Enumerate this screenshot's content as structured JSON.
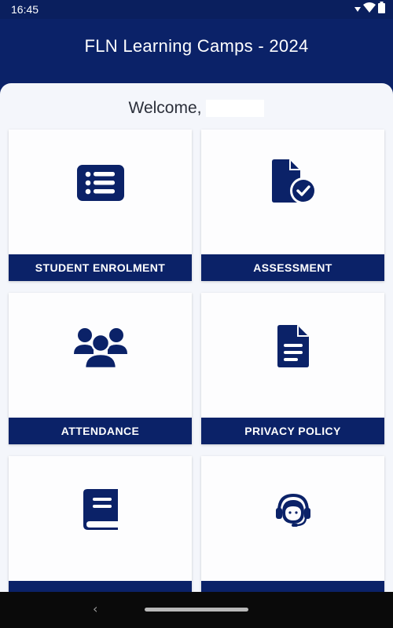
{
  "status_bar": {
    "time": "16:45",
    "icons": [
      "signal-dropdown-icon",
      "wifi-icon",
      "battery-icon"
    ]
  },
  "header": {
    "title": "FLN Learning Camps - 2024"
  },
  "welcome": {
    "greeting": "Welcome,",
    "user_name": ""
  },
  "tiles": [
    {
      "label": "STUDENT ENROLMENT",
      "icon": "list-icon"
    },
    {
      "label": "ASSESSMENT",
      "icon": "document-check-icon"
    },
    {
      "label": "ATTENDANCE",
      "icon": "group-icon"
    },
    {
      "label": "PRIVACY POLICY",
      "icon": "document-icon"
    },
    {
      "label": "",
      "icon": "book-icon"
    },
    {
      "label": "",
      "icon": "support-agent-icon"
    }
  ],
  "colors": {
    "primary": "#0b2268",
    "background": "#f4f6fb",
    "card": "#fdfdfe",
    "text": "#2b2f3a"
  },
  "nav": {
    "back_glyph": "‹"
  }
}
